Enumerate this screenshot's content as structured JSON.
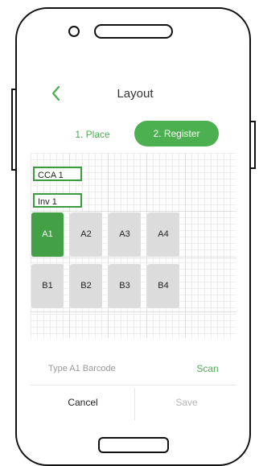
{
  "header": {
    "title": "Layout",
    "back_icon": "chevron-left-icon"
  },
  "tabs": [
    {
      "label": "1. Place",
      "active": false
    },
    {
      "label": "2. Register",
      "active": true
    }
  ],
  "rack": {
    "labels": [
      "CCA 1",
      "Inv 1"
    ],
    "slots": [
      {
        "label": "A1",
        "active": true
      },
      {
        "label": "A2",
        "active": false
      },
      {
        "label": "A3",
        "active": false
      },
      {
        "label": "A4",
        "active": false
      },
      {
        "label": "B1",
        "active": false
      },
      {
        "label": "B2",
        "active": false
      },
      {
        "label": "B3",
        "active": false
      },
      {
        "label": "B4",
        "active": false
      }
    ]
  },
  "barcode": {
    "placeholder": "Type A1 Barcode",
    "value": "",
    "scan_label": "Scan"
  },
  "footer": {
    "cancel_label": "Cancel",
    "save_label": "Save"
  },
  "colors": {
    "accent": "#4caf50",
    "slot_active": "#43a047",
    "slot_inactive": "#dcdcdc",
    "disabled_text": "#b5b5b5"
  }
}
